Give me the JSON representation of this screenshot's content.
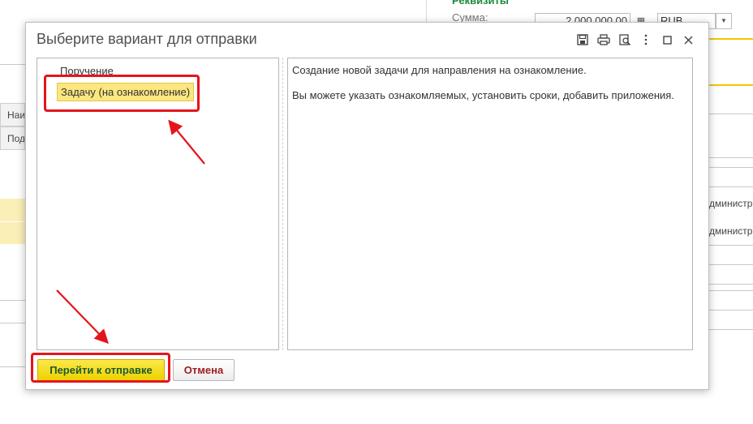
{
  "background": {
    "section_title": "Реквизиты",
    "sum_label": "Сумма:",
    "sum_value": "2 000 000,00",
    "currency": "RUB",
    "table_header_1": "Наим",
    "table_header_2": "Под",
    "right_text_1": "дминистр",
    "right_text_2": "дминистр"
  },
  "dialog": {
    "title": "Выберите вариант для отправки",
    "toolbar": [
      "save-icon",
      "print-icon",
      "preview-icon",
      "more-icon",
      "maximize-icon",
      "close-icon"
    ],
    "options": [
      {
        "label": "Поручение",
        "selected": false
      },
      {
        "label": "Задачу (на ознакомление)",
        "selected": true
      }
    ],
    "description": {
      "line1": "Создание новой задачи для направления на ознакомление.",
      "line2": "Вы можете указать ознакомляемых, установить сроки, добавить приложения."
    },
    "buttons": {
      "primary": "Перейти к отправке",
      "cancel": "Отмена"
    }
  },
  "colors": {
    "highlight": "#e5141c",
    "selection": "#fbe67f",
    "primary_button": "#f3dc1a",
    "section_title": "#1b8a3a"
  }
}
